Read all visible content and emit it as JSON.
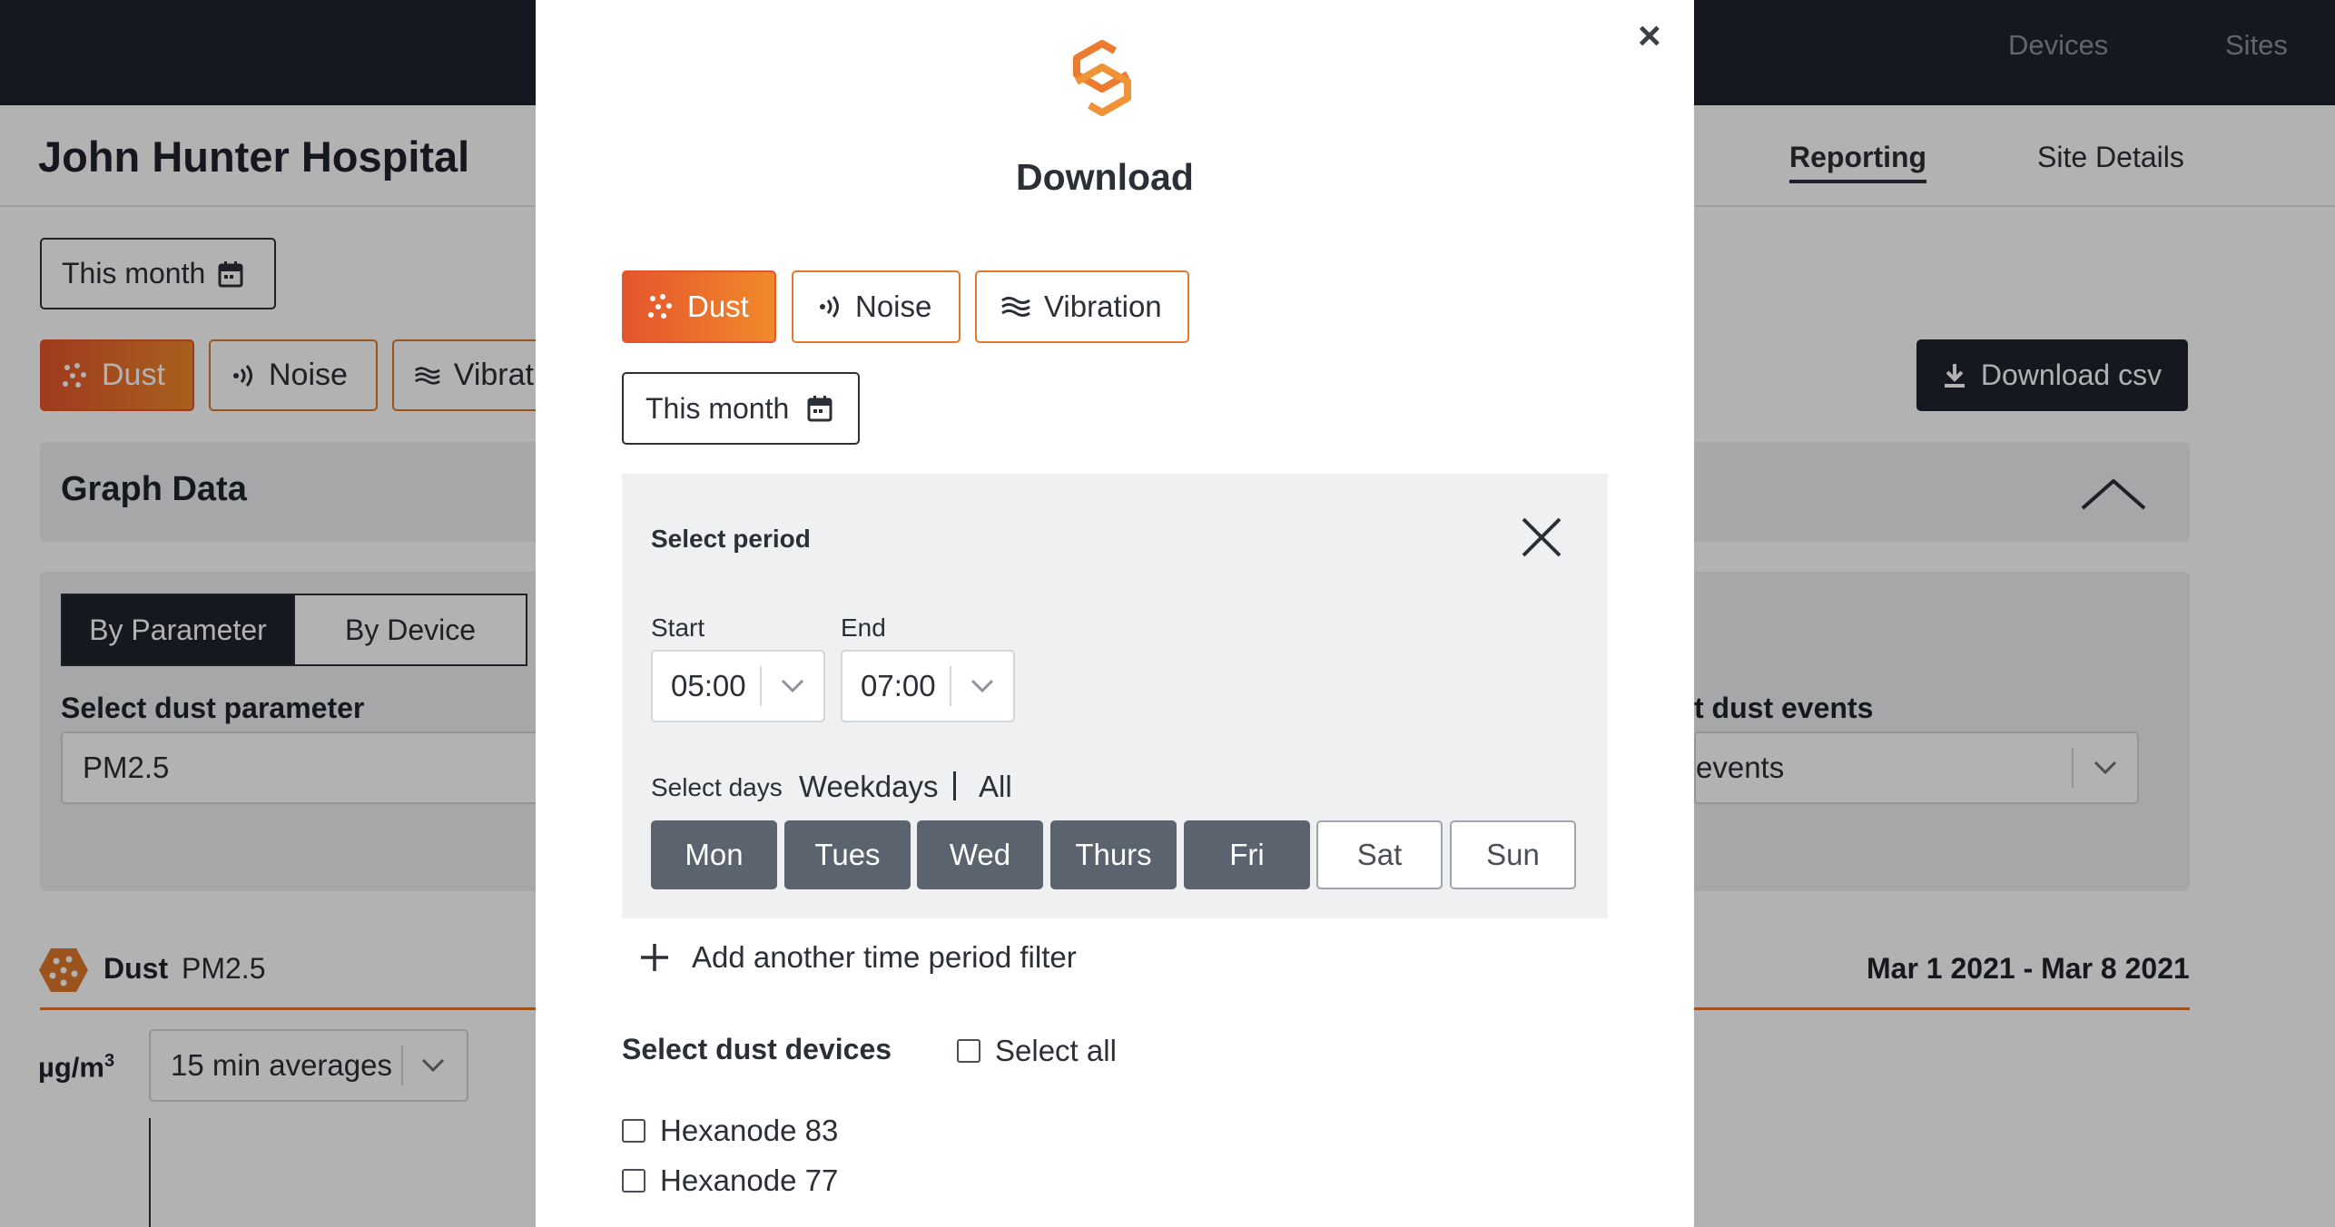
{
  "topnav": {
    "devices": "Devices",
    "sites": "Sites"
  },
  "page": {
    "site_title": "John Hunter Hospital",
    "tabs": {
      "reporting": "Reporting",
      "site_details": "Site Details"
    }
  },
  "bg_filters": {
    "date_range": "This month",
    "types": [
      "Dust",
      "Noise",
      "Vibrat"
    ],
    "download_csv": "Download csv"
  },
  "graph_panel": {
    "title": "Graph Data",
    "segments": [
      "By Parameter",
      "By Device"
    ],
    "param_label": "Select dust parameter",
    "param_value": "PM2.5",
    "events_label": "t dust events",
    "events_value": "events"
  },
  "chart_header": {
    "type": "Dust",
    "param": "PM2.5",
    "date_range": "Mar 1 2021 - Mar 8 2021",
    "unit": "µg/m",
    "unit_sup": "3",
    "averaging": "15 min averages"
  },
  "modal": {
    "title": "Download",
    "close_glyph": "×",
    "types": [
      {
        "label": "Dust",
        "active": true
      },
      {
        "label": "Noise",
        "active": false
      },
      {
        "label": "Vibration",
        "active": false
      }
    ],
    "date_range": "This month",
    "period": {
      "title": "Select period",
      "start_label": "Start",
      "start_value": "05:00",
      "end_label": "End",
      "end_value": "07:00",
      "days_label": "Select days",
      "weekdays_link": "Weekdays",
      "all_link": "All",
      "days": [
        {
          "label": "Mon",
          "selected": true
        },
        {
          "label": "Tues",
          "selected": true
        },
        {
          "label": "Wed",
          "selected": true
        },
        {
          "label": "Thurs",
          "selected": true
        },
        {
          "label": "Fri",
          "selected": true
        },
        {
          "label": "Sat",
          "selected": false
        },
        {
          "label": "Sun",
          "selected": false
        }
      ]
    },
    "add_filter": "Add another time period filter",
    "devices": {
      "title": "Select dust devices",
      "select_all": "Select all",
      "items": [
        "Hexanode 83",
        "Hexanode 77"
      ]
    }
  },
  "colors": {
    "accent": "#e5552c",
    "accent_light": "#f08a2c",
    "dark": "#1f232b",
    "day_selected": "#5a636e"
  }
}
